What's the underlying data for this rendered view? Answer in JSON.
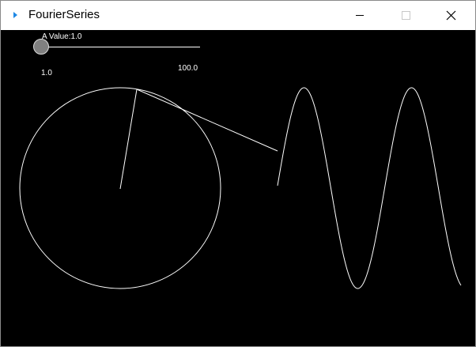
{
  "window": {
    "title": "FourierSeries",
    "icon": "play-triangle-icon",
    "accent": "#1e88e5",
    "buttons": [
      "minimize-icon",
      "maximize-icon",
      "close-icon"
    ]
  },
  "slider": {
    "label": "A Value:1.0",
    "value": 1.0,
    "min": 1.0,
    "max": 100.0,
    "min_label": "1.0",
    "max_label": "100.0"
  },
  "canvas": {
    "background": "#000000",
    "stroke": "#ffffff"
  }
}
